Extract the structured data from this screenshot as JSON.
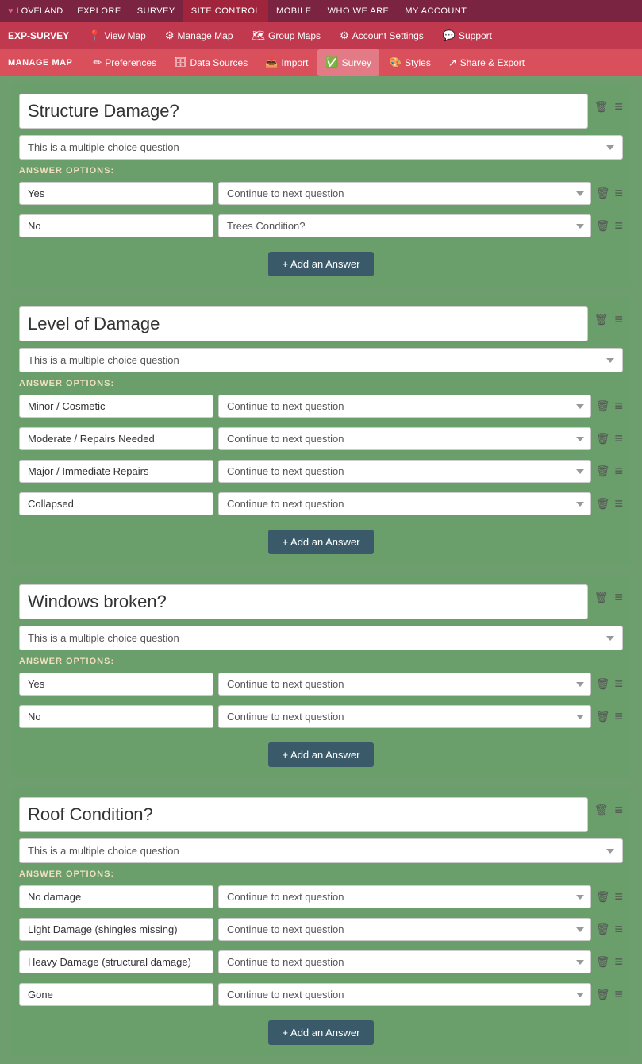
{
  "topNav": {
    "logo": "LOVELAND",
    "items": [
      {
        "id": "explore",
        "label": "EXPLORE"
      },
      {
        "id": "survey",
        "label": "SURVEY"
      },
      {
        "id": "site-control",
        "label": "SITE CONTROL",
        "active": true
      },
      {
        "id": "mobile",
        "label": "MOBILE"
      },
      {
        "id": "who-we-are",
        "label": "WHO WE ARE"
      },
      {
        "id": "my-account",
        "label": "MY ACCOUNT"
      }
    ]
  },
  "secondNav": {
    "brand": "EXP-SURVEY",
    "items": [
      {
        "id": "view-map",
        "label": "View Map",
        "icon": "pin"
      },
      {
        "id": "manage-map",
        "label": "Manage Map",
        "icon": "grid"
      },
      {
        "id": "group-maps",
        "label": "Group Maps",
        "icon": "group"
      },
      {
        "id": "account-settings",
        "label": "Account Settings",
        "icon": "acct"
      },
      {
        "id": "support",
        "label": "Support",
        "icon": "support"
      }
    ]
  },
  "thirdNav": {
    "brand": "MANAGE MAP",
    "items": [
      {
        "id": "preferences",
        "label": "Preferences",
        "icon": "pencil"
      },
      {
        "id": "data-sources",
        "label": "Data Sources",
        "icon": "db"
      },
      {
        "id": "import",
        "label": "Import",
        "icon": "import"
      },
      {
        "id": "survey",
        "label": "Survey",
        "icon": "check",
        "active": true
      },
      {
        "id": "styles",
        "label": "Styles",
        "icon": "style"
      },
      {
        "id": "share-export",
        "label": "Share & Export",
        "icon": "share"
      }
    ]
  },
  "questions": [
    {
      "id": "q1",
      "title": "Structure Damage?",
      "type": "This is a multiple choice question",
      "answers_label": "ANSWER OPTIONS:",
      "answers": [
        {
          "text": "Yes",
          "jump": "Continue to next question"
        },
        {
          "text": "No",
          "jump": "Trees Condition?"
        }
      ],
      "add_btn": "+ Add an Answer"
    },
    {
      "id": "q2",
      "title": "Level of Damage",
      "type": "This is a multiple choice question",
      "answers_label": "ANSWER OPTIONS:",
      "answers": [
        {
          "text": "Minor / Cosmetic",
          "jump": "Continue to next question"
        },
        {
          "text": "Moderate / Repairs Needed",
          "jump": "Continue to next question"
        },
        {
          "text": "Major / Immediate Repairs",
          "jump": "Continue to next question"
        },
        {
          "text": "Collapsed",
          "jump": "Continue to next question"
        }
      ],
      "add_btn": "+ Add an Answer"
    },
    {
      "id": "q3",
      "title": "Windows broken?",
      "type": "This is a multiple choice question",
      "answers_label": "ANSWER OPTIONS:",
      "answers": [
        {
          "text": "Yes",
          "jump": "Continue to next question"
        },
        {
          "text": "No",
          "jump": "Continue to next question"
        }
      ],
      "add_btn": "+ Add an Answer"
    },
    {
      "id": "q4",
      "title": "Roof Condition?",
      "type": "This is a multiple choice question",
      "answers_label": "ANSWER OPTIONS:",
      "answers": [
        {
          "text": "No damage",
          "jump": "Continue to next question"
        },
        {
          "text": "Light Damage (shingles missing)",
          "jump": "Continue to next question"
        },
        {
          "text": "Heavy Damage (structural damage)",
          "jump": "Continue to next question"
        },
        {
          "text": "Gone",
          "jump": "Continue to next question"
        }
      ],
      "add_btn": "+ Add an Answer"
    }
  ]
}
